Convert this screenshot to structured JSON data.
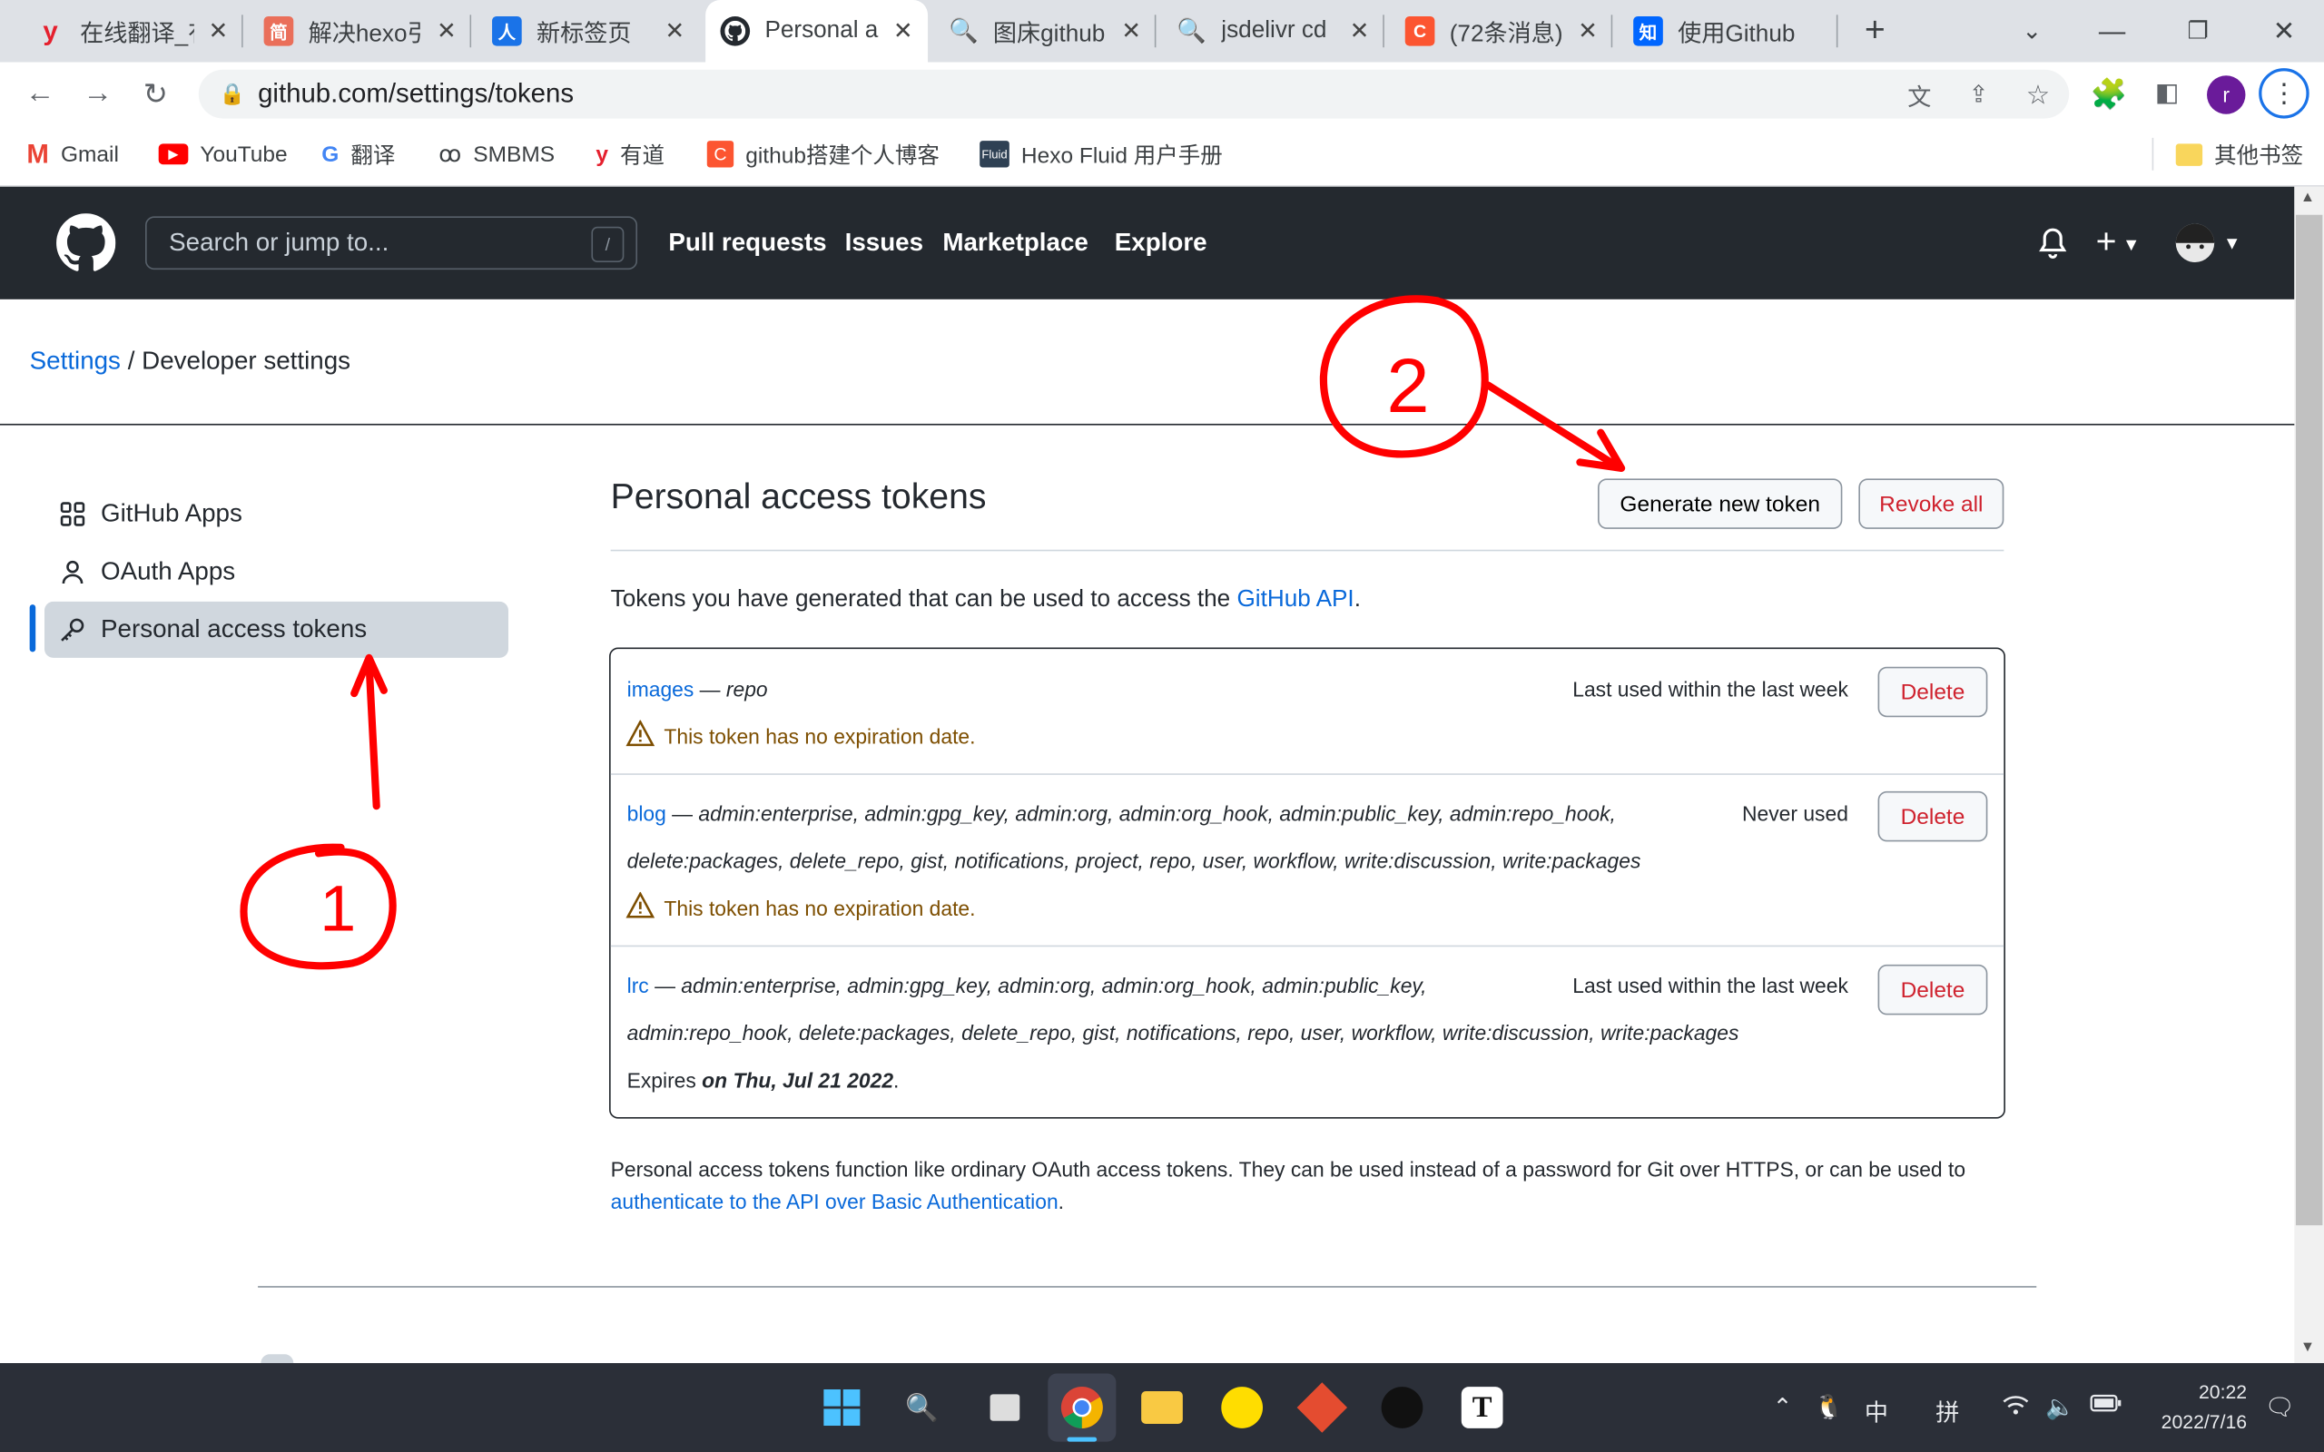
{
  "browser": {
    "tabs": [
      {
        "title": "在线翻译_有",
        "icon_letter": "y",
        "icon_color": "#e5202e"
      },
      {
        "title": "解决hexo引",
        "icon_letter": "简",
        "icon_color": "#ea6f5a"
      },
      {
        "title": "新标签页",
        "icon_letter": "人",
        "icon_color": "#1a73e8"
      },
      {
        "title": "Personal a",
        "icon_letter": "",
        "icon_color": "#24292f"
      },
      {
        "title": "图床github",
        "icon_letter": "Q",
        "icon_color": "#1a73e8"
      },
      {
        "title": "jsdelivr cd",
        "icon_letter": "Q",
        "icon_color": "#1a73e8"
      },
      {
        "title": "(72条消息)",
        "icon_letter": "C",
        "icon_color": "#fc5531"
      },
      {
        "title": "使用Github",
        "icon_letter": "知",
        "icon_color": "#0066ff"
      }
    ],
    "url": "github.com/settings/tokens",
    "profile_initial": "r",
    "bookmarks": [
      {
        "label": "Gmail",
        "icon": "gmail-icon"
      },
      {
        "label": "YouTube",
        "icon": "youtube-icon"
      },
      {
        "label": "翻译",
        "icon": "translate-icon"
      },
      {
        "label": "SMBMS",
        "icon": "smbms-icon"
      },
      {
        "label": "有道",
        "icon": "youdao-icon"
      },
      {
        "label": "github搭建个人博客",
        "icon": "csdn-icon"
      },
      {
        "label": "Hexo Fluid 用户手册",
        "icon": "fluid-icon"
      }
    ],
    "other_bookmarks": "其他书签"
  },
  "github": {
    "search_placeholder": "Search or jump to...",
    "search_shortcut": "/",
    "nav": [
      "Pull requests",
      "Issues",
      "Marketplace",
      "Explore"
    ]
  },
  "breadcrumb": {
    "root": "Settings",
    "separator": "/",
    "current": "Developer settings"
  },
  "sidebar": {
    "items": [
      {
        "label": "GitHub Apps",
        "icon": "apps-grid-icon"
      },
      {
        "label": "OAuth Apps",
        "icon": "person-icon"
      },
      {
        "label": "Personal access tokens",
        "icon": "key-icon"
      }
    ]
  },
  "main": {
    "title": "Personal access tokens",
    "generate_button": "Generate new token",
    "revoke_button": "Revoke all",
    "intro_prefix": "Tokens you have generated that can be used to access the ",
    "intro_link": "GitHub API",
    "intro_suffix": ".",
    "tokens": [
      {
        "name": "images",
        "scopes_line1": "repo",
        "scopes_line2": "",
        "last_used": "Last used within the last week",
        "note": "This token has no expiration date.",
        "delete": "Delete"
      },
      {
        "name": "blog",
        "scopes_line1": "admin:enterprise, admin:gpg_key, admin:org, admin:org_hook, admin:public_key, admin:repo_hook,",
        "scopes_line2": "delete:packages, delete_repo, gist, notifications, project, repo, user, workflow, write:discussion, write:packages",
        "last_used": "Never used",
        "note": "This token has no expiration date.",
        "delete": "Delete"
      },
      {
        "name": "lrc",
        "scopes_line1": "admin:enterprise, admin:gpg_key, admin:org, admin:org_hook, admin:public_key,",
        "scopes_line2": "admin:repo_hook, delete:packages, delete_repo, gist, notifications, repo, user, workflow, write:discussion, write:packages",
        "last_used": "Last used within the last week",
        "expires_prefix": "Expires ",
        "expires_date": "on Thu, Jul 21 2022",
        "expires_suffix": ".",
        "delete": "Delete"
      }
    ],
    "separator": "—",
    "footnote_text": "Personal access tokens function like ordinary OAuth access tokens. They can be used instead of a password for Git over HTTPS, or can be used to",
    "footnote_link": "authenticate to the API over Basic Authentication",
    "footnote_end": "."
  },
  "annotations": {
    "step1": "1",
    "step2": "2",
    "color": "#ff0000"
  },
  "taskbar": {
    "ime_lang": "中",
    "ime_mode": "拼",
    "time": "20:22",
    "date": "2022/7/16"
  },
  "colors": {
    "accent": "#0969da",
    "header": "#24292f",
    "danger": "#cf222e",
    "warning": "#9a6700"
  }
}
